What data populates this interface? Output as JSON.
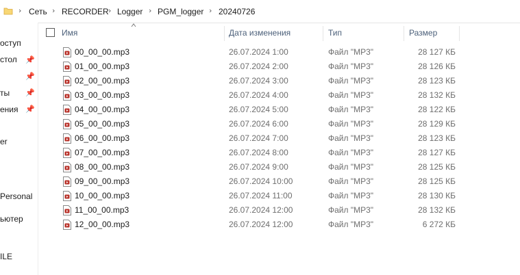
{
  "breadcrumb": {
    "folder_icon": "folder-icon",
    "separator_icon": "chevron-right-icon",
    "items": [
      "Сеть",
      "RECORDER",
      "Logger",
      "PGM_logger",
      "20240726"
    ]
  },
  "nav": {
    "items": [
      {
        "label": "оступ",
        "pinned": false
      },
      {
        "label": "стол",
        "pinned": true
      },
      {
        "label": "",
        "pinned": true
      },
      {
        "label": "ты",
        "pinned": true
      },
      {
        "label": "ения",
        "pinned": true
      },
      {
        "label": "er",
        "pinned": false
      },
      {
        "label": "Personal",
        "pinned": false
      },
      {
        "label": "ьютер",
        "pinned": false
      },
      {
        "label": "ILE",
        "pinned": false
      }
    ],
    "pin_icon": "pin-icon"
  },
  "columns": {
    "name": "Имя",
    "date": "Дата изменения",
    "type": "Тип",
    "size": "Размер",
    "sort_icon": "sort-up-icon"
  },
  "files": [
    {
      "name": "00_00_00.mp3",
      "date": "26.07.2024 1:00",
      "type": "Файл \"MP3\"",
      "size": "28 127 КБ"
    },
    {
      "name": "01_00_00.mp3",
      "date": "26.07.2024 2:00",
      "type": "Файл \"MP3\"",
      "size": "28 126 КБ"
    },
    {
      "name": "02_00_00.mp3",
      "date": "26.07.2024 3:00",
      "type": "Файл \"MP3\"",
      "size": "28 123 КБ"
    },
    {
      "name": "03_00_00.mp3",
      "date": "26.07.2024 4:00",
      "type": "Файл \"MP3\"",
      "size": "28 132 КБ"
    },
    {
      "name": "04_00_00.mp3",
      "date": "26.07.2024 5:00",
      "type": "Файл \"MP3\"",
      "size": "28 122 КБ"
    },
    {
      "name": "05_00_00.mp3",
      "date": "26.07.2024 6:00",
      "type": "Файл \"MP3\"",
      "size": "28 129 КБ"
    },
    {
      "name": "06_00_00.mp3",
      "date": "26.07.2024 7:00",
      "type": "Файл \"MP3\"",
      "size": "28 123 КБ"
    },
    {
      "name": "07_00_00.mp3",
      "date": "26.07.2024 8:00",
      "type": "Файл \"MP3\"",
      "size": "28 127 КБ"
    },
    {
      "name": "08_00_00.mp3",
      "date": "26.07.2024 9:00",
      "type": "Файл \"MP3\"",
      "size": "28 125 КБ"
    },
    {
      "name": "09_00_00.mp3",
      "date": "26.07.2024 10:00",
      "type": "Файл \"MP3\"",
      "size": "28 125 КБ"
    },
    {
      "name": "10_00_00.mp3",
      "date": "26.07.2024 11:00",
      "type": "Файл \"MP3\"",
      "size": "28 130 КБ"
    },
    {
      "name": "11_00_00.mp3",
      "date": "26.07.2024 12:00",
      "type": "Файл \"MP3\"",
      "size": "28 132 КБ"
    },
    {
      "name": "12_00_00.mp3",
      "date": "26.07.2024 12:00",
      "type": "Файл \"MP3\"",
      "size": "6 272 КБ"
    }
  ],
  "colors": {
    "header_text": "#4c607a",
    "secondary_text": "#6d6d6d",
    "folder_yellow": "#f8d775",
    "mp3_icon_red": "#b8322a"
  }
}
